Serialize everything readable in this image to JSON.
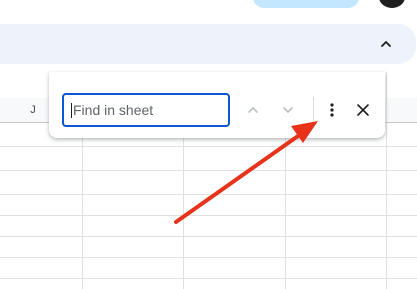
{
  "header": {
    "share_button_color": "#c2e7ff",
    "avatar_color": "#1f1f1f"
  },
  "toolbar": {
    "background": "#eef2fb",
    "collapse_icon": "chevron-up-icon"
  },
  "sheet": {
    "visible_column": "J"
  },
  "find_bar": {
    "placeholder": "Find in sheet",
    "value": "",
    "previous_icon": "chevron-up-icon",
    "next_icon": "chevron-down-icon",
    "more_icon": "more-vertical-icon",
    "close_icon": "close-icon",
    "accent": "#0b57d0"
  },
  "annotation": {
    "type": "arrow",
    "color": "#e8321a",
    "points_to": "more-options-button"
  }
}
